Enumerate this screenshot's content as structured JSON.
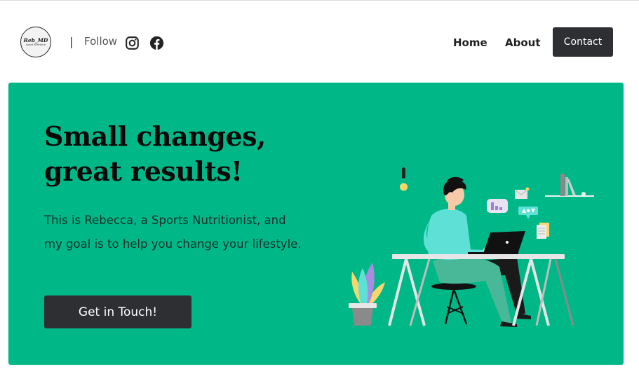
{
  "header": {
    "logo": {
      "line1": "Reb_MD",
      "line2": "Sport Nutrition"
    },
    "separator": "|",
    "follow_label": "Follow",
    "social_icons": [
      "instagram-icon",
      "facebook-icon"
    ],
    "nav": {
      "home": "Home",
      "about": "About",
      "contact": "Contact"
    }
  },
  "hero": {
    "headline_line1": "Small changes,",
    "headline_line2": "great results!",
    "lead": "This is Rebecca, a Sports Nutritionist, and my goal is to help you change your lifestyle.",
    "cta_label": "Get in Touch!",
    "illustration": "person-working-at-desk-illustration"
  },
  "colors": {
    "hero_background": "#00b887",
    "dark_button": "#2d2f33",
    "text_dark": "#0a0a0a"
  }
}
